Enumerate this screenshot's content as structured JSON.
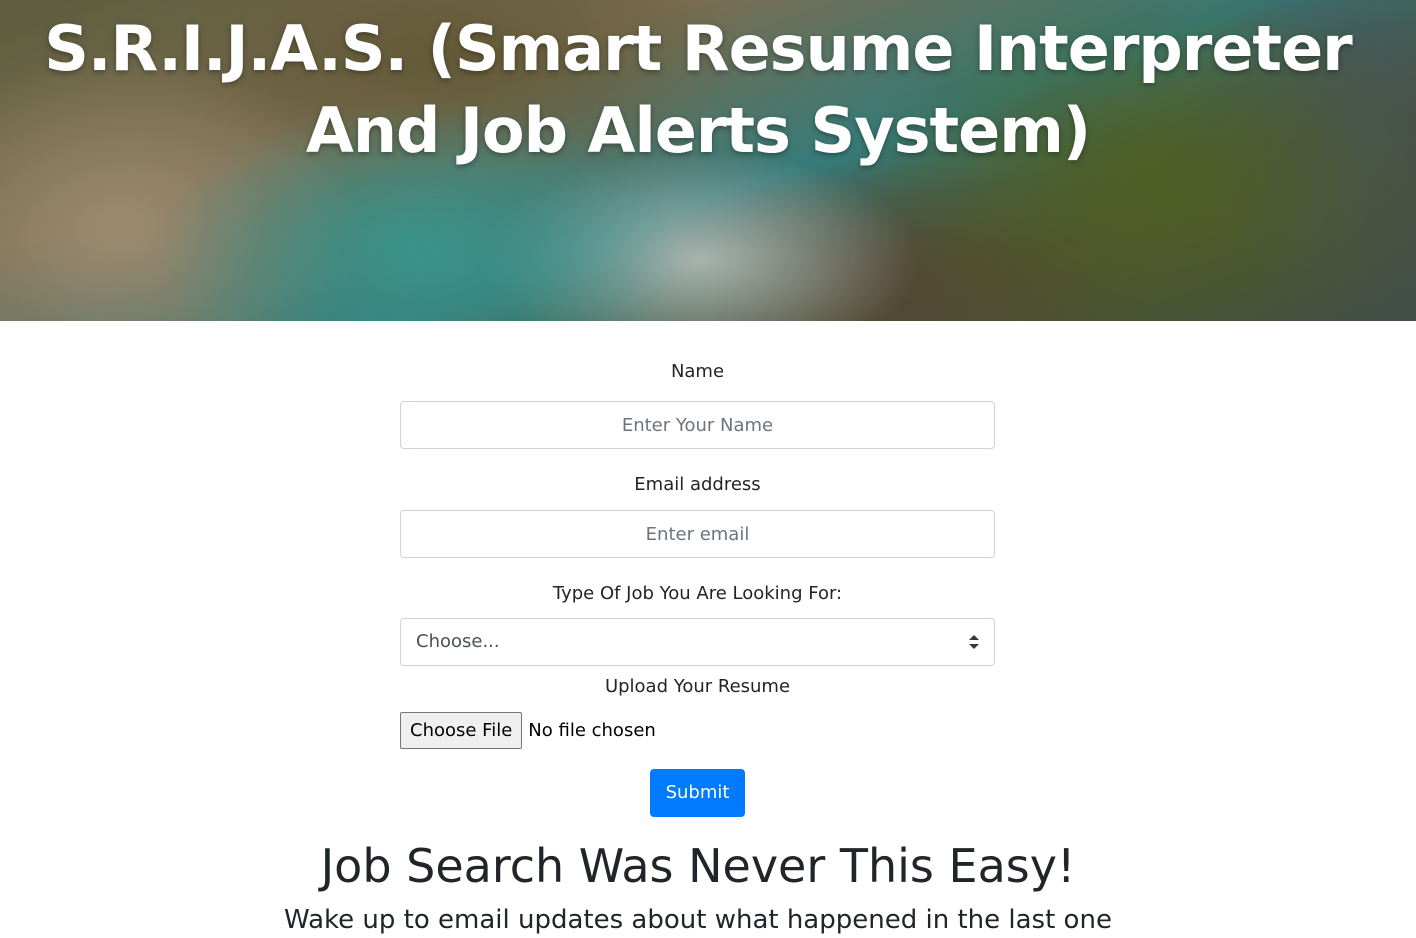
{
  "hero": {
    "title": "S.R.I.J.A.S. (Smart Resume Interpreter And Job Alerts System)"
  },
  "form": {
    "name_label": "Name",
    "name_placeholder": "Enter Your Name",
    "email_label": "Email address",
    "email_placeholder": "Enter email",
    "job_type_label": "Type Of Job You Are Looking For:",
    "job_type_selected": "Choose...",
    "resume_label": "Upload Your Resume",
    "file_button_label": "Choose File",
    "file_status": "No file chosen",
    "submit_label": "Submit"
  },
  "content": {
    "tagline": "Job Search Was Never This Easy!",
    "subline": "Wake up to email updates about what happened in the last one"
  },
  "colors": {
    "primary": "#007bff",
    "text": "#212529",
    "input_border": "#ced4da"
  }
}
